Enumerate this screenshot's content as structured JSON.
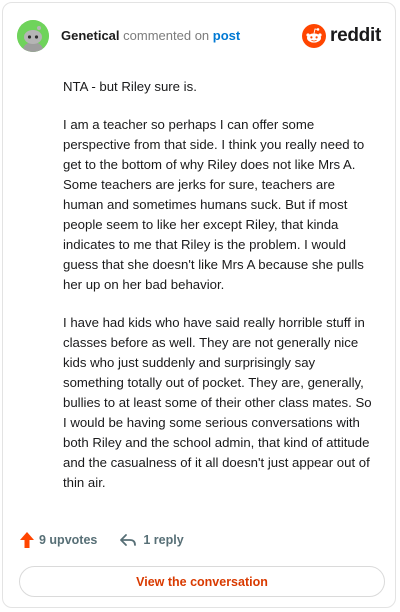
{
  "header": {
    "username": "Genetical",
    "action_text": "commented on",
    "post_link": "post",
    "brand": "reddit"
  },
  "comment": {
    "paragraphs": [
      "NTA - but Riley sure is.",
      "I am a teacher so perhaps I can offer some perspective from that side. I think you really need to get to the bottom of why Riley does not like Mrs A. Some teachers are jerks for sure, teachers are human and sometimes humans suck. But if most people seem to like her except Riley, that kinda indicates to me that Riley is the problem. I would guess that she doesn't like Mrs A because she pulls her up on her bad behavior.",
      "I have had kids who have said really horrible stuff in classes before as well. They are not generally nice kids who just suddenly and surprisingly say something totally out of pocket. They are, generally, bullies to at least some of their other class mates. So I would be having some serious conversations with both Riley and the school admin, that kind of attitude and the casualness of it all doesn't just appear out of thin air."
    ]
  },
  "footer": {
    "upvotes": "9 upvotes",
    "replies": "1 reply",
    "view_button": "View the conversation"
  },
  "colors": {
    "brand_orange": "#ff4500",
    "link_blue": "#0079d3",
    "avatar_green": "#6fd35b",
    "button_text": "#d93a00"
  },
  "icons": {
    "avatar": "snoo-avatar-icon",
    "logo": "reddit-logo-icon",
    "upvote": "upvote-arrow-icon",
    "reply": "reply-arrow-icon"
  }
}
